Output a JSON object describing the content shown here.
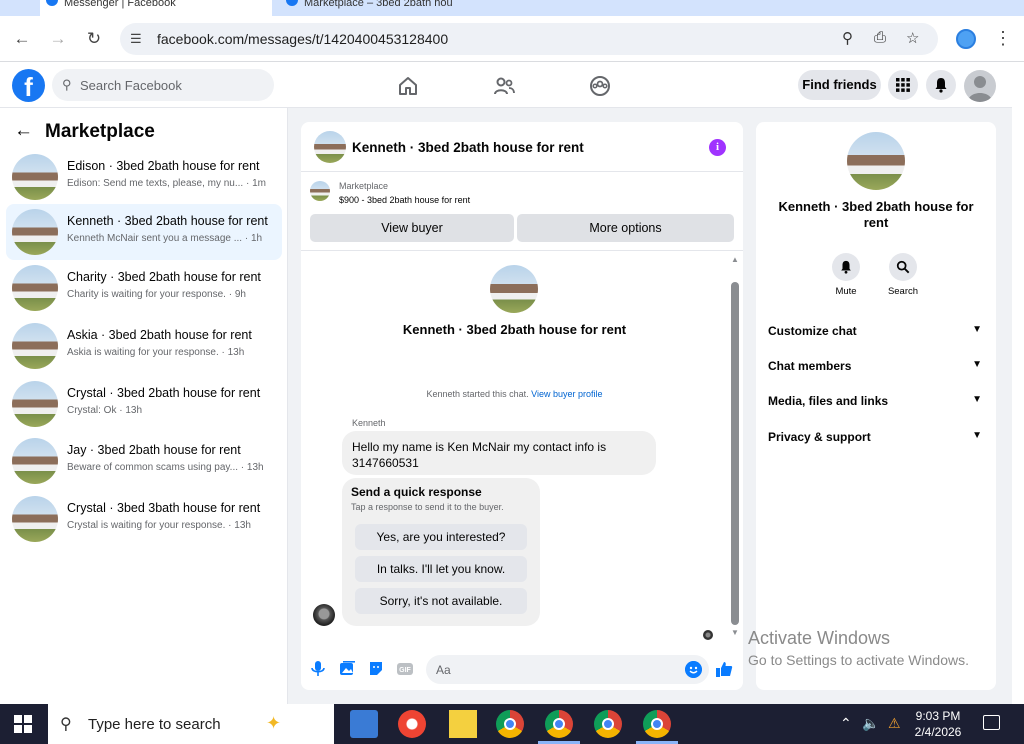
{
  "browser": {
    "tabs": [
      {
        "title": "Messenger | Facebook"
      },
      {
        "title": "Marketplace – 3bed 2bath hou"
      }
    ],
    "url": "facebook.com/messages/t/1420400453128400"
  },
  "header": {
    "search_placeholder": "Search Facebook",
    "find_friends": "Find friends"
  },
  "sidebar": {
    "title": "Marketplace",
    "conversations": [
      {
        "title": "Edison · 3bed 2bath house for rent",
        "preview": "Edison: Send me texts, please, my nu... · 1m",
        "active": false
      },
      {
        "title": "Kenneth · 3bed 2bath house for rent",
        "preview": "Kenneth McNair sent you a message ... · 1h",
        "active": true
      },
      {
        "title": "Charity · 3bed 2bath house for rent",
        "preview": "Charity is waiting for your response. · 9h",
        "active": false
      },
      {
        "title": "Askia · 3bed 2bath house for rent",
        "preview": "Askia is waiting for your response. · 13h",
        "active": false
      },
      {
        "title": "Crystal · 3bed 2bath house for rent",
        "preview": "Crystal: Ok · 13h",
        "active": false
      },
      {
        "title": "Jay · 3bed 2bath house for rent",
        "preview": "Beware of common scams using pay... · 13h",
        "active": false
      },
      {
        "title": "Crystal · 3bed 3bath house for rent",
        "preview": "Crystal is waiting for your response. · 13h",
        "active": false
      }
    ]
  },
  "chat": {
    "title": "Kenneth · 3bed 2bath house for rent",
    "marketplace_label": "Marketplace",
    "listing": "$900 - 3bed 2bath house for rent",
    "view_buyer": "View buyer",
    "more_options": "More options",
    "intro_title": "Kenneth · 3bed 2bath house for rent",
    "started_text": "Kenneth started this chat.",
    "view_profile": "View buyer profile",
    "sender": "Kenneth",
    "message": "Hello my name is Ken McNair my contact info is 3147660531",
    "quick_title": "Send a quick response",
    "quick_sub": "Tap a response to send it to the buyer.",
    "quick_options": [
      "Yes, are you interested?",
      "In talks. I'll let you know.",
      "Sorry, it's not available."
    ],
    "composer_placeholder": "Aa"
  },
  "details": {
    "title": "Kenneth · 3bed 2bath house for rent",
    "actions": [
      {
        "label": "Mute",
        "icon": "bell-icon"
      },
      {
        "label": "Search",
        "icon": "search-icon"
      }
    ],
    "sections": [
      "Customize chat",
      "Chat members",
      "Media, files and links",
      "Privacy & support"
    ]
  },
  "watermark": {
    "line1": "Activate Windows",
    "line2": "Go to Settings to activate Windows."
  },
  "taskbar": {
    "search_placeholder": "Type here to search",
    "time": "9:03 PM",
    "date": "2/4/2026"
  },
  "colors": {
    "brand": "#1877f2",
    "active_row": "#ebf5ff",
    "info": "#a033ff",
    "taskbar": "#1c1f33"
  }
}
